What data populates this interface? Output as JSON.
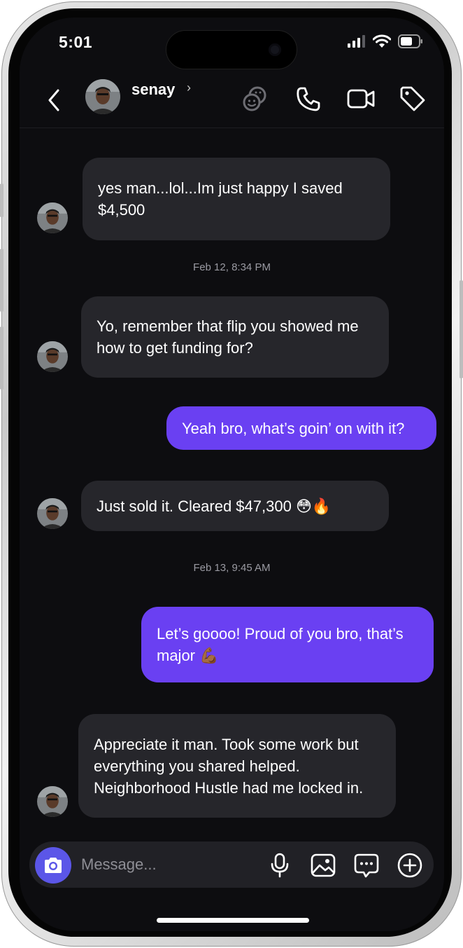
{
  "status_bar": {
    "time": "5:01"
  },
  "header": {
    "contact_name": "senay",
    "chevron": "›"
  },
  "messages": [
    {
      "direction": "in",
      "text": "yes man...lol...Im just happy I saved $4,500"
    },
    {
      "direction": "timestamp",
      "text": "Feb 12, 8:34 PM"
    },
    {
      "direction": "in",
      "text": "Yo, remember that flip you showed me how to get funding for?"
    },
    {
      "direction": "out",
      "text": "Yeah bro, what’s goin’ on with it?"
    },
    {
      "direction": "in",
      "text": "Just sold it. Cleared $47,300 😳🔥"
    },
    {
      "direction": "timestamp",
      "text": "Feb 13, 9:45 AM"
    },
    {
      "direction": "out",
      "text": "Let’s goooo! Proud of you bro, that’s major 💪🏾"
    },
    {
      "direction": "in",
      "text": "Appreciate it man. Took some work but everything you shared helped. Neighborhood Hustle had me locked in."
    }
  ],
  "composer": {
    "placeholder": "Message..."
  },
  "icons": {
    "status": [
      "cellular-signal-icon",
      "wifi-icon",
      "battery-icon"
    ],
    "header": [
      "back-chevron-icon",
      "stickers-icon",
      "phone-icon",
      "video-camera-icon",
      "tag-icon"
    ],
    "composer": [
      "camera-icon",
      "microphone-icon",
      "image-icon",
      "chat-bubble-icon",
      "plus-circle-icon"
    ]
  },
  "colors": {
    "screen_bg": "#0d0d10",
    "incoming_bubble": "#26262b",
    "outgoing_bubble": "#6a40f2",
    "camera_button": "#5b56e8",
    "timestamp_text": "#9a9aa2"
  }
}
